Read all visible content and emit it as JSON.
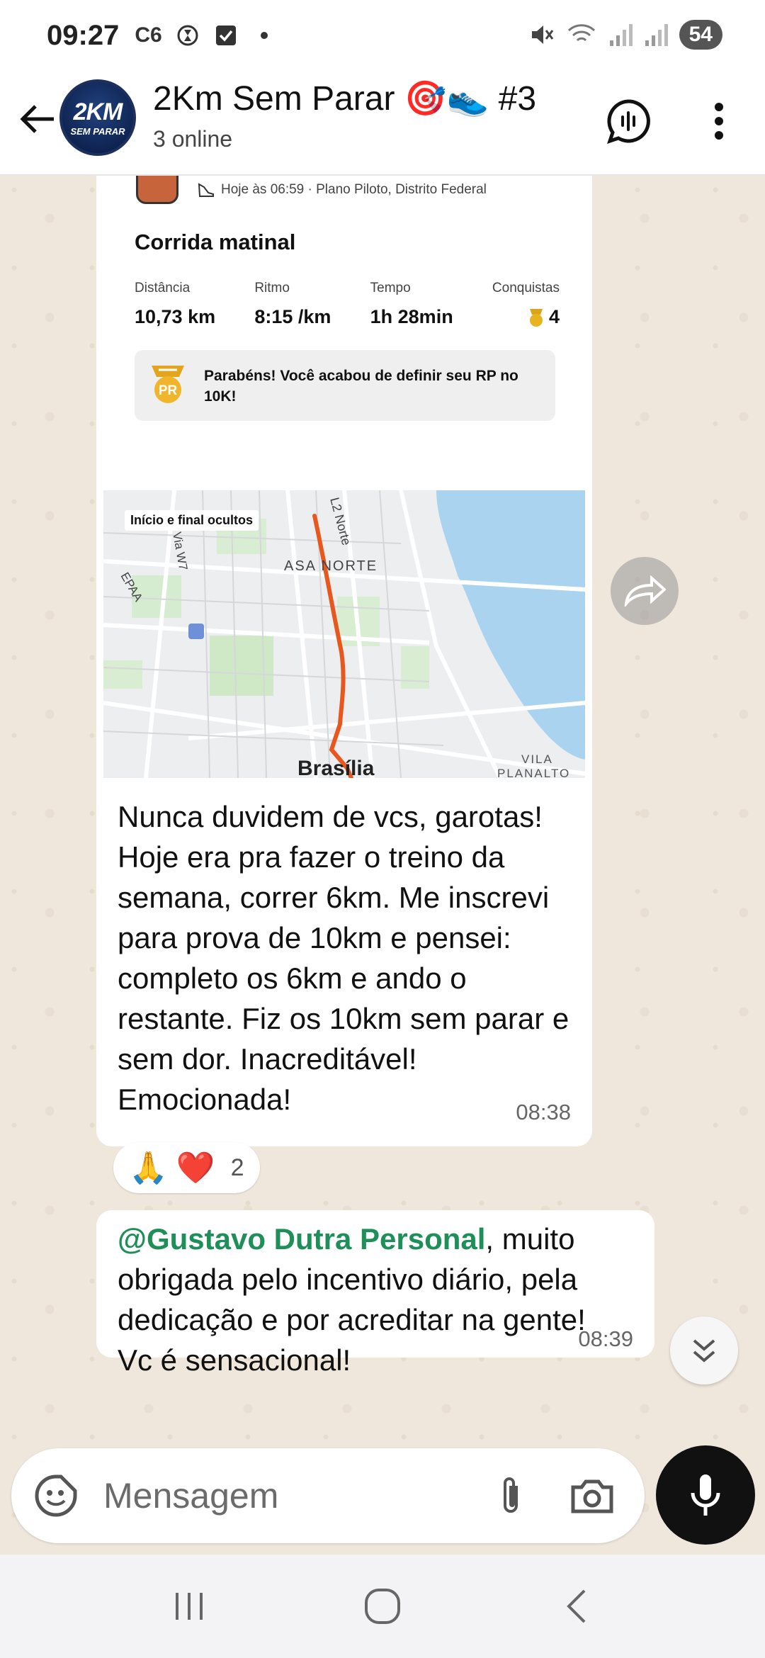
{
  "status_bar": {
    "time": "09:27",
    "carrier_label": "C6",
    "battery": "54"
  },
  "header": {
    "avatar_line1": "2KM",
    "avatar_line2": "SEM PARAR",
    "title": "2Km Sem Parar 🎯👟 #3",
    "subtitle": "3 online"
  },
  "activity": {
    "meta": "Hoje às 06:59 · Plano Piloto, Distrito Federal",
    "title": "Corrida matinal",
    "stats": [
      {
        "label": "Distância",
        "value": "10,73 km"
      },
      {
        "label": "Ritmo",
        "value": "8:15 /km"
      },
      {
        "label": "Tempo",
        "value": "1h 28min"
      },
      {
        "label": "Conquistas",
        "value": "4"
      }
    ],
    "pr_badge_label": "PR",
    "pr_text": "Parabéns! Você acabou de definir seu RP no 10K!"
  },
  "map": {
    "hidden_label": "Início e final ocultos",
    "labels": {
      "asa_norte": "ASA NORTE",
      "l2_norte": "L2 Norte",
      "via_w7": "Via W7",
      "epaa": "EPAA",
      "brasilia": "Brasília",
      "vila": "VILA",
      "planalto": "PLANALTO"
    }
  },
  "messages": [
    {
      "text": "Nunca duvidem de vcs, garotas! Hoje era pra fazer o treino da semana, correr 6km. Me inscrevi para prova de 10km e pensei: completo os 6km e ando o restante. Fiz os 10km sem parar e sem dor. Inacreditável! Emocionada!",
      "time": "08:38"
    },
    {
      "mention": "@Gustavo Dutra Personal",
      "text": ", muito obrigada pelo incentivo diário, pela dedicação e por acreditar na gente!\nVc é sensacional!",
      "time": "08:39"
    }
  ],
  "reactions": {
    "emoji1": "🙏",
    "emoji2": "❤️",
    "count": "2"
  },
  "input": {
    "placeholder": "Mensagem"
  },
  "colors": {
    "mention": "#1f8f5a",
    "route": "#e8571e",
    "chat_bg": "#efe7dc",
    "mic_button": "#111111"
  }
}
